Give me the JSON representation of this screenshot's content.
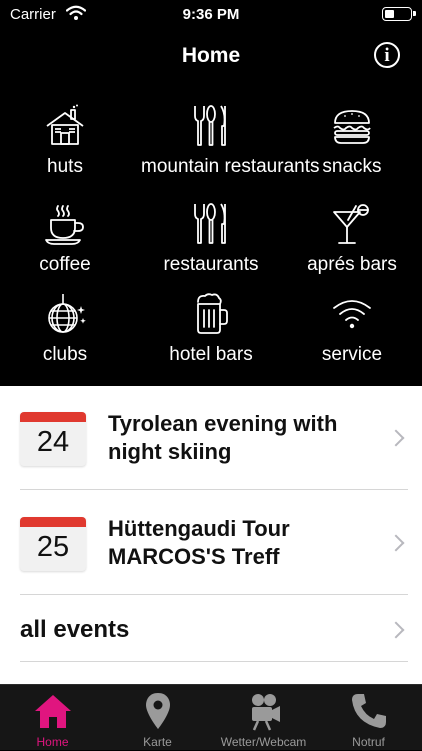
{
  "status_bar": {
    "carrier": "Carrier",
    "time": "9:36 PM"
  },
  "nav": {
    "title": "Home",
    "info_glyph": "i"
  },
  "categories": [
    {
      "label": "huts",
      "icon": "hut-icon"
    },
    {
      "label": "mountain restaurants",
      "icon": "cutlery-icon"
    },
    {
      "label": "snacks",
      "icon": "burger-icon"
    },
    {
      "label": "coffee",
      "icon": "coffee-cup-icon"
    },
    {
      "label": "restaurants",
      "icon": "cutlery-icon"
    },
    {
      "label": "aprés bars",
      "icon": "cocktail-icon"
    },
    {
      "label": "clubs",
      "icon": "disco-ball-icon"
    },
    {
      "label": "hotel bars",
      "icon": "beer-mug-icon"
    },
    {
      "label": "service",
      "icon": "wifi-icon"
    }
  ],
  "events": [
    {
      "day": "24",
      "title": "Tyrolean evening with night skiing"
    },
    {
      "day": "25",
      "title": "Hüttengaudi Tour MARCOS'S Treff"
    }
  ],
  "all_events_label": "all events",
  "tabs": [
    {
      "label": "Home",
      "icon": "house-icon",
      "active": true
    },
    {
      "label": "Karte",
      "icon": "map-pin-icon",
      "active": false
    },
    {
      "label": "Wetter/Webcam",
      "icon": "movie-camera-icon",
      "active": false
    },
    {
      "label": "Notruf",
      "icon": "phone-icon",
      "active": false
    }
  ],
  "colors": {
    "accent": "#e0157f",
    "calendar_red": "#e0392f",
    "background": "#000000"
  }
}
